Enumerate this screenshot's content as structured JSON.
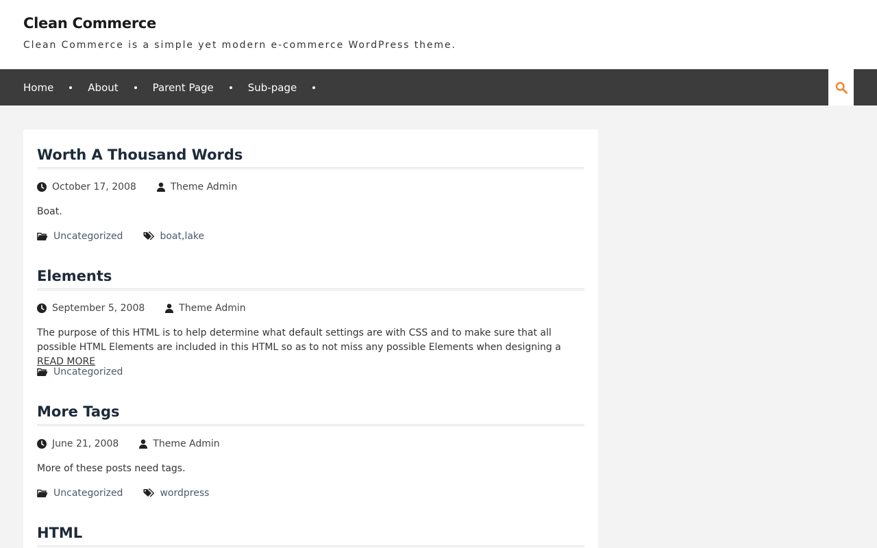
{
  "site": {
    "title": "Clean Commerce",
    "description": "Clean Commerce is a simple yet modern e-commerce WordPress theme."
  },
  "nav": {
    "items": [
      {
        "label": "Home"
      },
      {
        "label": "About"
      },
      {
        "label": "Parent Page"
      },
      {
        "label": "Sub-page"
      }
    ],
    "search_icon": "search-icon"
  },
  "colors": {
    "accent": "#f0842c",
    "nav_bg": "#3c3c3c",
    "page_bg": "#f3f3f3"
  },
  "posts": [
    {
      "title": "Worth A Thousand Words",
      "date": "October 17, 2008",
      "author": "Theme Admin",
      "excerpt": "Boat.",
      "category": "Uncategorized",
      "tags": [
        "boat",
        "lake"
      ]
    },
    {
      "title": "Elements",
      "date": "September 5, 2008",
      "author": "Theme Admin",
      "excerpt": "The purpose of this HTML is to help determine what default settings are with CSS and to make sure that all possible HTML Elements are included in this HTML so as to not miss any possible Elements when designing a",
      "read_more": "READ MORE",
      "category": "Uncategorized",
      "tags": []
    },
    {
      "title": "More Tags",
      "date": "June 21, 2008",
      "author": "Theme Admin",
      "excerpt": "More of these posts need tags.",
      "category": "Uncategorized",
      "tags": [
        "wordpress"
      ]
    },
    {
      "title": "HTML"
    }
  ]
}
